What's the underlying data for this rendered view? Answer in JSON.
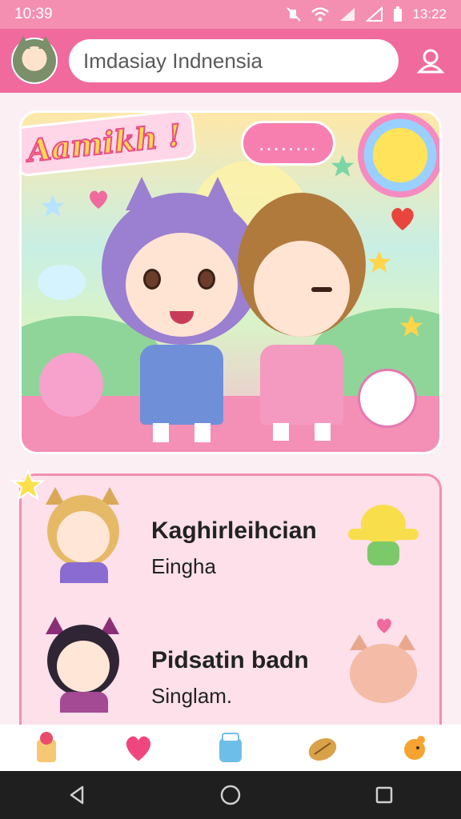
{
  "status_bar": {
    "time": "10:39",
    "clock": "13:22",
    "icons": [
      "mute-icon",
      "wifi-icon",
      "signal-icon",
      "signal-2-icon",
      "battery-icon"
    ]
  },
  "app_bar": {
    "search_value": "Imdasiay Indnensia",
    "profile_icon": "person-icon"
  },
  "hero": {
    "title": "Aamikh !",
    "speech": "........"
  },
  "list": {
    "items": [
      {
        "title": "Kaghirleihcian",
        "subtitle": "Eingha"
      },
      {
        "title": "Pidsatin badn",
        "subtitle": "Singlam."
      }
    ]
  },
  "bottom_nav": {
    "items": [
      "snack-icon",
      "heart-icon",
      "milk-icon",
      "ball-icon",
      "bird-icon"
    ]
  },
  "system_nav": {
    "items": [
      "back-icon",
      "home-icon",
      "recents-icon"
    ]
  },
  "colors": {
    "primary": "#f06a9e",
    "status": "#f48fb1",
    "card_bg": "#fde0ea"
  }
}
